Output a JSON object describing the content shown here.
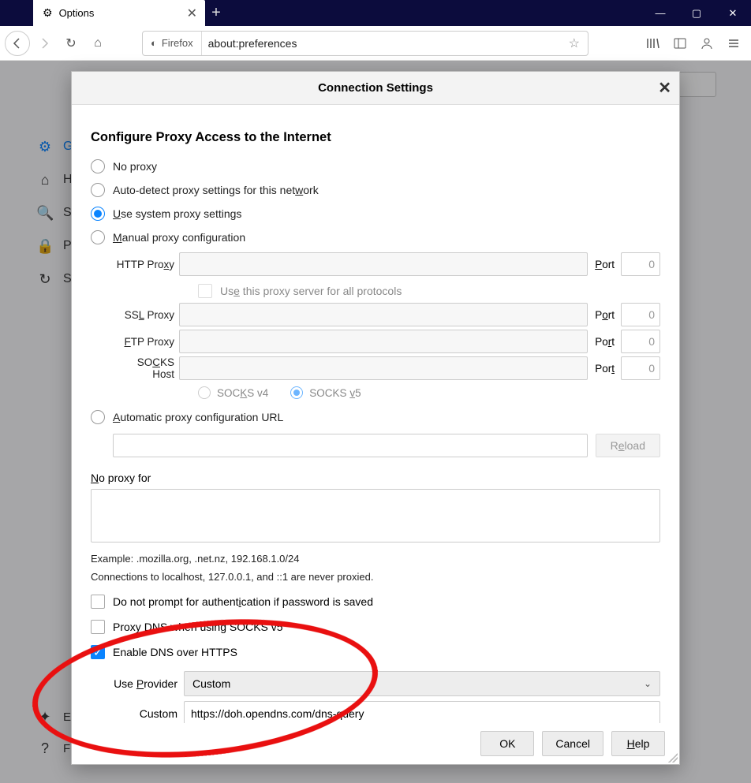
{
  "window": {
    "tab_title": "Options",
    "newtab": "+",
    "minimize": "—",
    "maximize": "▢",
    "close": "✕"
  },
  "toolbar": {
    "identity": "Firefox",
    "url": "about:preferences"
  },
  "sidebar": {
    "items": [
      {
        "icon": "⚙",
        "label": "General"
      },
      {
        "icon": "⌂",
        "label": "Home"
      },
      {
        "icon": "🔍",
        "label": "Search"
      },
      {
        "icon": "🔒",
        "label": "Privacy & Security"
      },
      {
        "icon": "↻",
        "label": "Sync"
      }
    ],
    "bottom": [
      {
        "icon": "✦",
        "label": "Extensions & Themes"
      },
      {
        "icon": "?",
        "label": "Firefox Support"
      }
    ]
  },
  "dialog": {
    "title": "Connection Settings",
    "heading": "Configure Proxy Access to the Internet",
    "radios": {
      "no_proxy": "No proxy",
      "auto_detect": "Auto-detect proxy settings for this network",
      "system": "Use system proxy settings",
      "manual": "Manual proxy configuration",
      "pac": "Automatic proxy configuration URL"
    },
    "fields": {
      "http_label": "HTTP Proxy",
      "ssl_label": "SSL Proxy",
      "ftp_label": "FTP Proxy",
      "socks_label": "SOCKS Host",
      "port_label": "Port",
      "port_value": "0",
      "use_all": "Use this proxy server for all protocols",
      "socks_v4": "SOCKS v4",
      "socks_v5": "SOCKS v5",
      "reload": "Reload",
      "no_proxy_for": "No proxy for",
      "example": "Example: .mozilla.org, .net.nz, 192.168.1.0/24",
      "localhost_hint": "Connections to localhost, 127.0.0.1, and ::1 are never proxied.",
      "no_prompt": "Do not prompt for authentication if password is saved",
      "proxy_dns": "Proxy DNS when using SOCKS v5",
      "enable_doh": "Enable DNS over HTTPS",
      "use_provider": "Use Provider",
      "provider_value": "Custom",
      "custom_label": "Custom",
      "custom_value": "https://doh.opendns.com/dns-query"
    },
    "buttons": {
      "ok": "OK",
      "cancel": "Cancel",
      "help": "Help"
    }
  }
}
